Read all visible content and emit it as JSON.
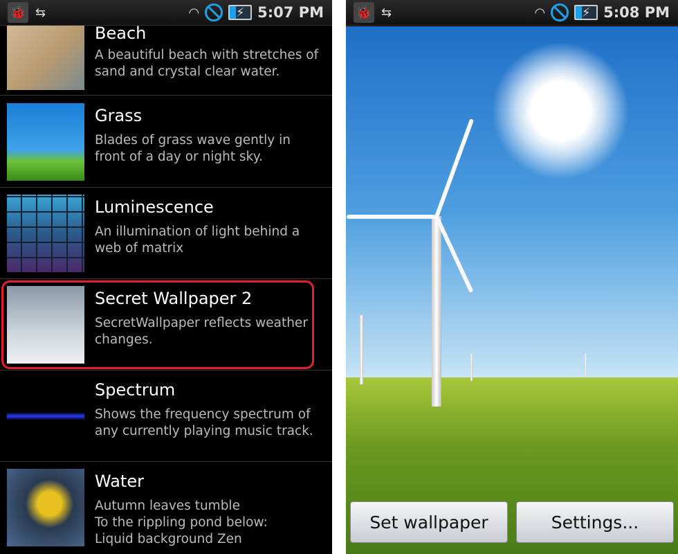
{
  "left": {
    "status": {
      "time": "5:07 PM",
      "icons": [
        "android-debug-icon",
        "usb-icon",
        "wifi-icon",
        "no-sync-icon",
        "battery-charging-icon"
      ]
    },
    "items": [
      {
        "title": "Beach",
        "description": "A beautiful beach with stretches of sand and crystal clear water."
      },
      {
        "title": "Grass",
        "description": "Blades of grass wave gently in front of a day or night sky."
      },
      {
        "title": "Luminescence",
        "description": "An illumination of light behind a web of matrix"
      },
      {
        "title": "Secret Wallpaper 2",
        "description": "SecretWallpaper reflects weather changes.",
        "highlighted": true
      },
      {
        "title": "Spectrum",
        "description": "Shows the frequency spectrum of any currently playing music track."
      },
      {
        "title": "Water",
        "description": "Autumn leaves tumble\nTo the rippling pond below:\nLiquid background Zen"
      }
    ]
  },
  "right": {
    "status": {
      "time": "5:08 PM"
    },
    "set_wallpaper": "Set wallpaper",
    "settings": "Settings..."
  },
  "colors": {
    "highlight": "#e0202a",
    "accent": "#1ea0e8"
  }
}
